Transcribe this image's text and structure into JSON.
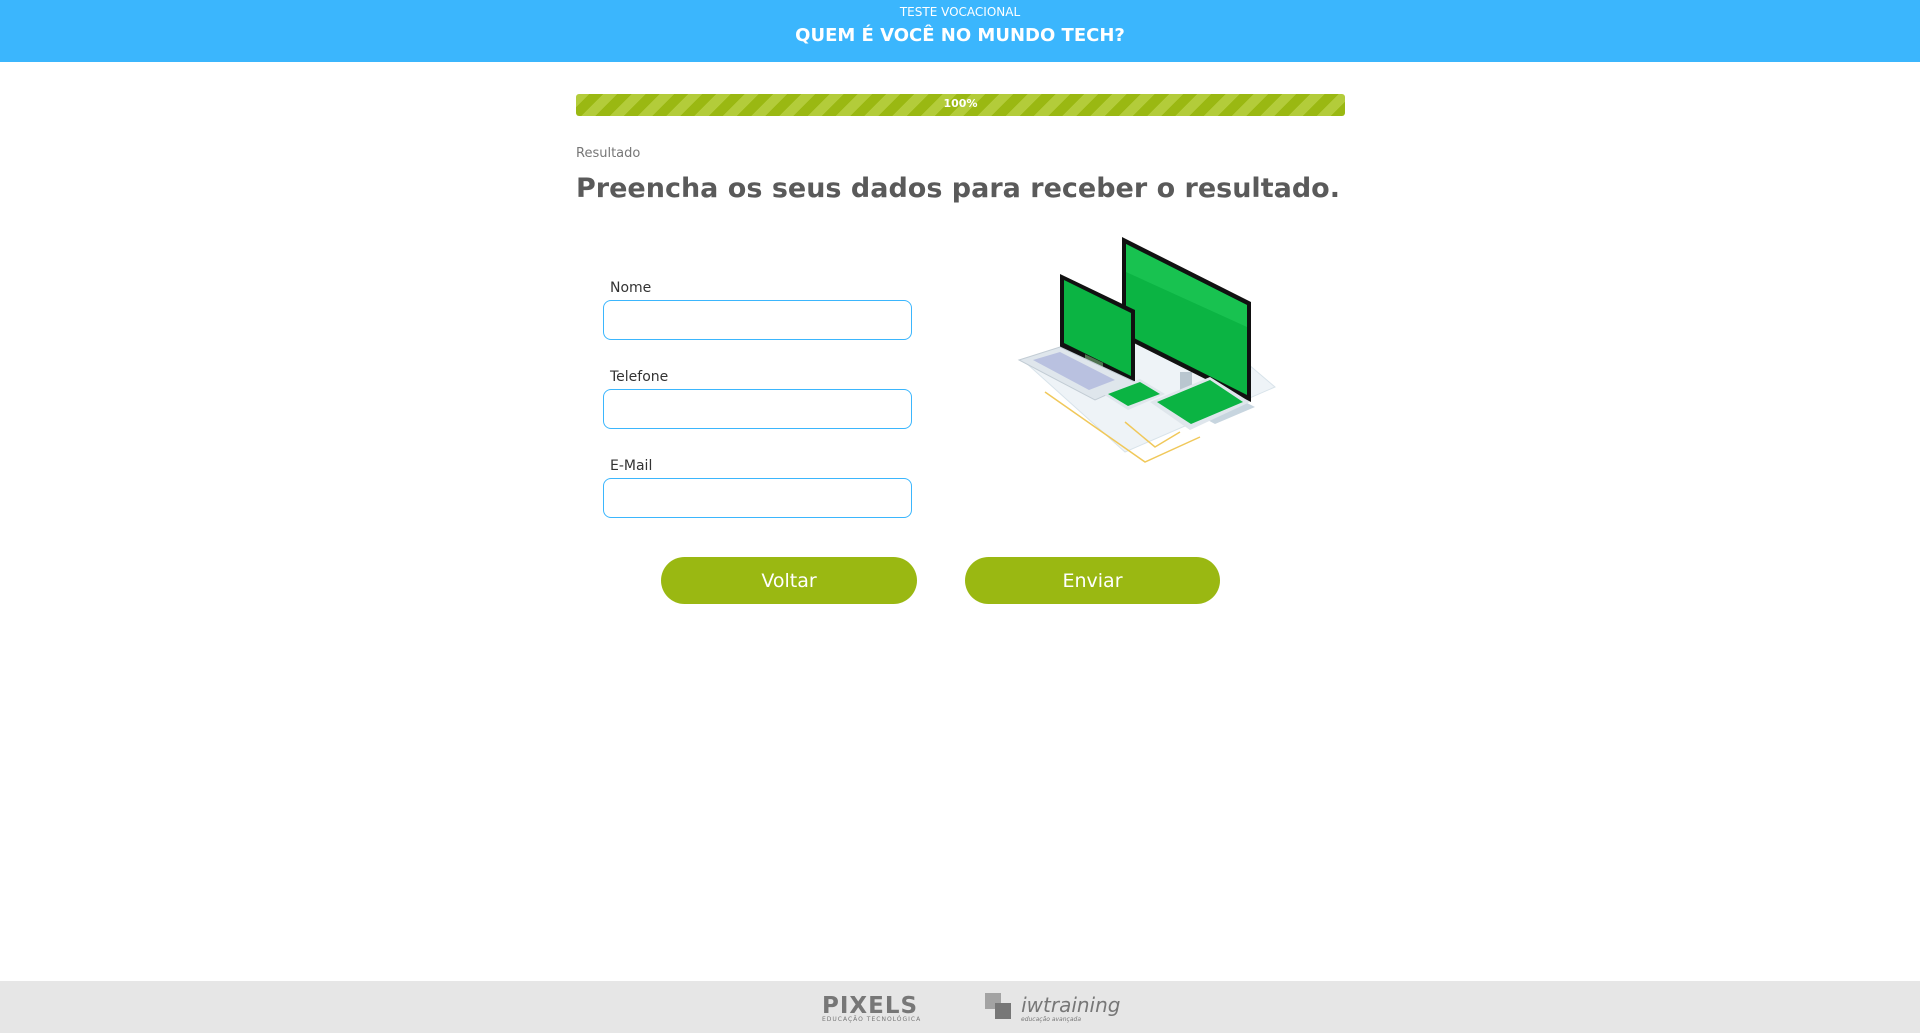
{
  "header": {
    "subtitle": "TESTE VOCACIONAL",
    "title": "QUEM É VOCÊ NO MUNDO TECH?",
    "background_color": "#3bb6fd"
  },
  "progress": {
    "value_percent": 100,
    "label": "100%",
    "color": "#9ab812"
  },
  "step": {
    "label": "Resultado",
    "heading": "Preencha os seus dados para receber o resultado."
  },
  "form": {
    "fields": [
      {
        "label": "Nome",
        "value": ""
      },
      {
        "label": "Telefone",
        "value": ""
      },
      {
        "label": "E-Mail",
        "value": ""
      }
    ]
  },
  "actions": {
    "back_label": "Voltar",
    "send_label": "Enviar",
    "button_color": "#9ab812"
  },
  "illustration": {
    "icon": "devices-illustration",
    "screen_color": "#0bb443"
  },
  "footer": {
    "logos": [
      {
        "name": "PIXELS",
        "tagline": "EDUCAÇÃO TECNOLÓGICA"
      },
      {
        "name": "iwtraining",
        "tagline": "educação avançada"
      }
    ]
  }
}
